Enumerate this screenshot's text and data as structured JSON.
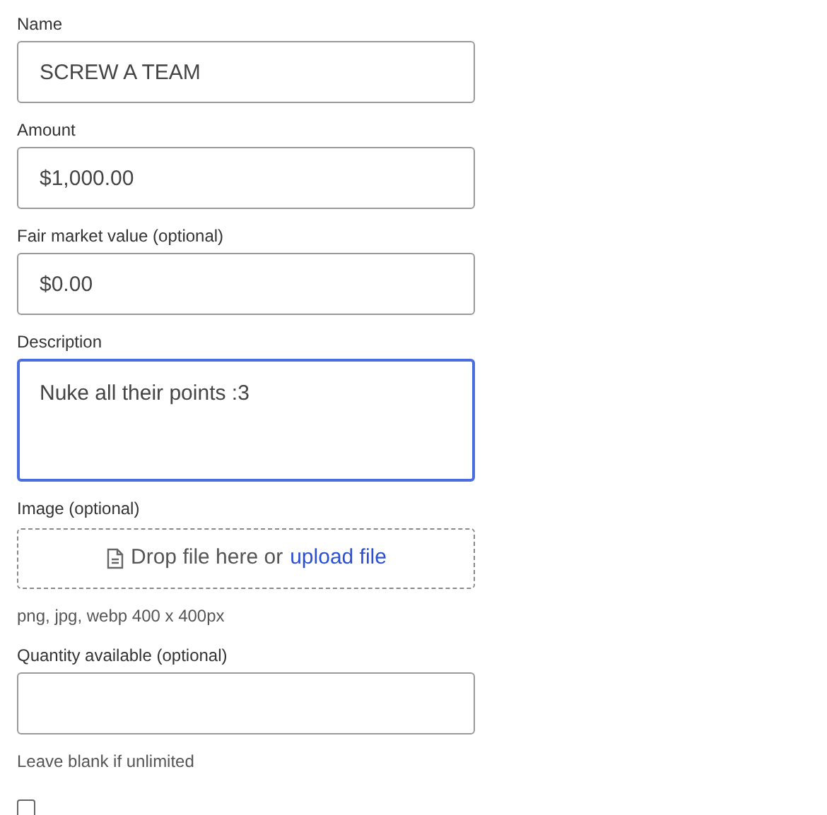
{
  "fields": [
    {
      "kind": "text",
      "label": "Name",
      "value": "SCREW A TEAM",
      "focused": false
    },
    {
      "kind": "text",
      "label": "Amount",
      "value": "$1,000.00",
      "focused": false
    },
    {
      "kind": "text",
      "label": "Fair market value (optional)",
      "value": "$0.00",
      "focused": false
    },
    {
      "kind": "textarea",
      "label": "Description",
      "value": "Nuke all their points :3",
      "focused": true
    },
    {
      "kind": "upload",
      "label": "Image (optional)",
      "drop_text": "Drop file here or",
      "link": "upload file",
      "hint": "png, jpg, webp 400 x 400px"
    },
    {
      "kind": "text",
      "label": "Quantity available (optional)",
      "focused": false,
      "hint": "Leave blank if unlimited"
    },
    {
      "kind": "checkbox",
      "checked": false
    }
  ]
}
